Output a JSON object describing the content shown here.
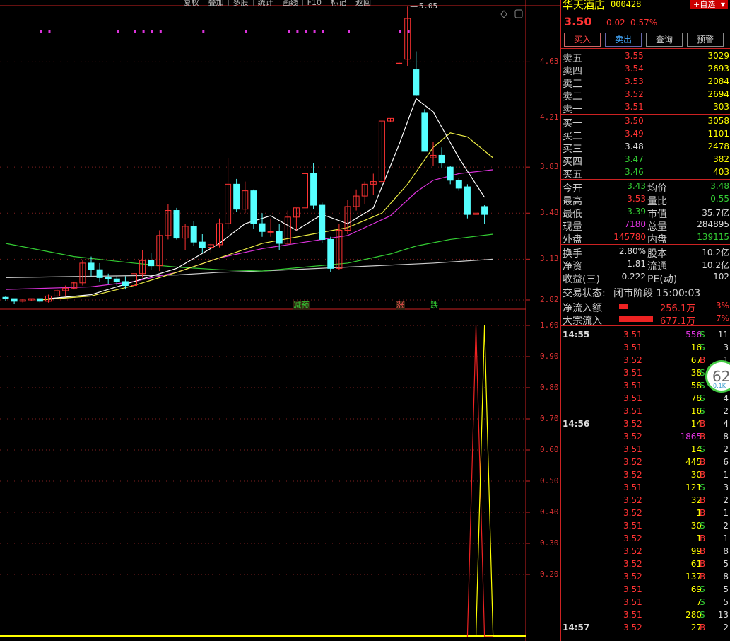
{
  "toolbar": [
    "复权",
    "叠加",
    "多股",
    "统计",
    "画线",
    "F10",
    "标记",
    "返回"
  ],
  "price_axis": [
    "4.63",
    "4.21",
    "3.83",
    "3.48",
    "3.13",
    "2.82"
  ],
  "osc_axis": [
    "1.00",
    "0.90",
    "0.80",
    "0.70",
    "0.60",
    "0.50",
    "0.40",
    "0.30",
    "0.20"
  ],
  "high_label": "5.05",
  "signals": [
    {
      "label": "减预",
      "color": "#3c3",
      "bg": "#321"
    },
    {
      "label": "涨",
      "color": "#f55",
      "bg": "#321"
    },
    {
      "label": "跌",
      "color": "#3c3",
      "bg": "#000"
    }
  ],
  "stock": {
    "name": "华天酒店",
    "code": "000428",
    "register": "+自选",
    "price": "3.50",
    "change": "0.02",
    "pct": "0.57%"
  },
  "actions": {
    "buy": "买入",
    "sell": "卖出",
    "query": "查询",
    "alert": "预警"
  },
  "asks": [
    {
      "l": "卖五",
      "p": "3.55",
      "v": "3029"
    },
    {
      "l": "卖四",
      "p": "3.54",
      "v": "2693"
    },
    {
      "l": "卖三",
      "p": "3.53",
      "v": "2084"
    },
    {
      "l": "卖二",
      "p": "3.52",
      "v": "2694"
    },
    {
      "l": "卖一",
      "p": "3.51",
      "v": "303"
    }
  ],
  "bids": [
    {
      "l": "买一",
      "p": "3.50",
      "v": "3058"
    },
    {
      "l": "买二",
      "p": "3.49",
      "v": "1101"
    },
    {
      "l": "买三",
      "p": "3.48",
      "v": "2478"
    },
    {
      "l": "买四",
      "p": "3.47",
      "v": "382"
    },
    {
      "l": "买五",
      "p": "3.46",
      "v": "403"
    }
  ],
  "stats1": [
    {
      "a": "今开",
      "av": "3.43",
      "ac": "g",
      "b": "均价",
      "bv": "3.48",
      "bc": "g"
    },
    {
      "a": "最高",
      "av": "3.53",
      "ac": "r",
      "b": "量比",
      "bv": "0.55",
      "bc": "g"
    },
    {
      "a": "最低",
      "av": "3.39",
      "ac": "g",
      "b": "市值",
      "bv": "35.7亿",
      "bc": "w"
    },
    {
      "a": "现量",
      "av": "7180",
      "ac": "m",
      "b": "总量",
      "bv": "284895",
      "bc": "w"
    },
    {
      "a": "外盘",
      "av": "145780",
      "ac": "r",
      "b": "内盘",
      "bv": "139115",
      "bc": "g"
    }
  ],
  "stats2": [
    {
      "a": "换手",
      "av": "2.80%",
      "b": "股本",
      "bv": "10.2亿"
    },
    {
      "a": "净资",
      "av": "1.81",
      "b": "流通",
      "bv": "10.2亿"
    },
    {
      "a": "收益(三)",
      "av": "-0.222",
      "b": "PE(动)",
      "bv": "102"
    }
  ],
  "status": {
    "label": "交易状态:",
    "value": "闭市阶段 15:00:03"
  },
  "flows": [
    {
      "l": "净流入额",
      "v": "256.1万",
      "p": "3%"
    },
    {
      "l": "大宗流入",
      "v": "677.1万",
      "p": "7%"
    }
  ],
  "ticks": [
    {
      "t": "14:55",
      "p": "3.51",
      "v": "556",
      "bs": "S",
      "n": "11",
      "vc": "m"
    },
    {
      "t": "",
      "p": "3.51",
      "v": "16",
      "bs": "S",
      "n": "3",
      "vc": "y"
    },
    {
      "t": "",
      "p": "3.52",
      "v": "67",
      "bs": "B",
      "n": "1",
      "vc": "y"
    },
    {
      "t": "",
      "p": "3.51",
      "v": "38",
      "bs": "S",
      "n": "4",
      "vc": "y"
    },
    {
      "t": "",
      "p": "3.51",
      "v": "58",
      "bs": "S",
      "n": "4",
      "vc": "y"
    },
    {
      "t": "",
      "p": "3.51",
      "v": "78",
      "bs": "S",
      "n": "4",
      "vc": "y"
    },
    {
      "t": "",
      "p": "3.51",
      "v": "16",
      "bs": "S",
      "n": "2",
      "vc": "y"
    },
    {
      "t": "14:56",
      "p": "3.52",
      "v": "14",
      "bs": "B",
      "n": "4",
      "vc": "y"
    },
    {
      "t": "",
      "p": "3.52",
      "v": "1865",
      "bs": "B",
      "n": "8",
      "vc": "m"
    },
    {
      "t": "",
      "p": "3.51",
      "v": "14",
      "bs": "S",
      "n": "2",
      "vc": "y"
    },
    {
      "t": "",
      "p": "3.52",
      "v": "445",
      "bs": "B",
      "n": "6",
      "vc": "y"
    },
    {
      "t": "",
      "p": "3.52",
      "v": "30",
      "bs": "B",
      "n": "1",
      "vc": "y"
    },
    {
      "t": "",
      "p": "3.51",
      "v": "121",
      "bs": "S",
      "n": "3",
      "vc": "y"
    },
    {
      "t": "",
      "p": "3.52",
      "v": "32",
      "bs": "B",
      "n": "2",
      "vc": "y"
    },
    {
      "t": "",
      "p": "3.52",
      "v": "1",
      "bs": "B",
      "n": "1",
      "vc": "y"
    },
    {
      "t": "",
      "p": "3.51",
      "v": "30",
      "bs": "S",
      "n": "2",
      "vc": "y"
    },
    {
      "t": "",
      "p": "3.52",
      "v": "1",
      "bs": "B",
      "n": "1",
      "vc": "y"
    },
    {
      "t": "",
      "p": "3.52",
      "v": "99",
      "bs": "B",
      "n": "8",
      "vc": "y"
    },
    {
      "t": "",
      "p": "3.52",
      "v": "61",
      "bs": "B",
      "n": "5",
      "vc": "y"
    },
    {
      "t": "",
      "p": "3.52",
      "v": "137",
      "bs": "B",
      "n": "8",
      "vc": "y"
    },
    {
      "t": "",
      "p": "3.51",
      "v": "69",
      "bs": "S",
      "n": "5",
      "vc": "y"
    },
    {
      "t": "",
      "p": "3.51",
      "v": "7",
      "bs": "S",
      "n": "5",
      "vc": "y"
    },
    {
      "t": "",
      "p": "3.51",
      "v": "280",
      "bs": "S",
      "n": "13",
      "vc": "y"
    },
    {
      "t": "14:57",
      "p": "3.52",
      "v": "27",
      "bs": "B",
      "n": "2",
      "vc": "y"
    }
  ],
  "badge": {
    "num": "62",
    "sub": "0.1K"
  },
  "chart_data": {
    "type": "candlestick",
    "ylim": [
      2.75,
      5.1
    ],
    "candles": [
      [
        2.84,
        2.85,
        2.81,
        2.83
      ],
      [
        2.83,
        2.83,
        2.79,
        2.81
      ],
      [
        2.81,
        2.83,
        2.8,
        2.82
      ],
      [
        2.82,
        2.83,
        2.81,
        2.83
      ],
      [
        2.83,
        2.83,
        2.8,
        2.81
      ],
      [
        2.81,
        2.86,
        2.8,
        2.85
      ],
      [
        2.85,
        2.9,
        2.84,
        2.89
      ],
      [
        2.89,
        2.93,
        2.85,
        2.91
      ],
      [
        2.91,
        2.96,
        2.9,
        2.95
      ],
      [
        2.95,
        3.12,
        2.93,
        3.1
      ],
      [
        3.1,
        3.15,
        3.0,
        3.05
      ],
      [
        3.05,
        3.1,
        2.96,
        2.99
      ],
      [
        2.99,
        3.02,
        2.94,
        2.98
      ],
      [
        2.98,
        3.0,
        2.93,
        2.96
      ],
      [
        2.96,
        3.0,
        2.9,
        2.93
      ],
      [
        2.93,
        3.05,
        2.92,
        3.02
      ],
      [
        3.02,
        3.2,
        2.99,
        3.12
      ],
      [
        3.12,
        3.18,
        3.05,
        3.08
      ],
      [
        3.08,
        3.35,
        3.04,
        3.31
      ],
      [
        3.31,
        3.55,
        3.28,
        3.5
      ],
      [
        3.5,
        3.52,
        3.28,
        3.29
      ],
      [
        3.29,
        3.4,
        3.2,
        3.38
      ],
      [
        3.38,
        3.42,
        3.23,
        3.26
      ],
      [
        3.26,
        3.32,
        3.18,
        3.22
      ],
      [
        3.22,
        3.25,
        3.18,
        3.24
      ],
      [
        3.24,
        3.44,
        3.22,
        3.4
      ],
      [
        3.4,
        3.9,
        3.36,
        3.7
      ],
      [
        3.7,
        3.74,
        3.49,
        3.51
      ],
      [
        3.51,
        3.72,
        3.48,
        3.65
      ],
      [
        3.65,
        3.66,
        3.36,
        3.4
      ],
      [
        3.4,
        3.48,
        3.3,
        3.34
      ],
      [
        3.34,
        3.44,
        3.3,
        3.34
      ],
      [
        3.34,
        3.4,
        3.2,
        3.25
      ],
      [
        3.25,
        3.5,
        3.24,
        3.45
      ],
      [
        3.45,
        3.52,
        3.35,
        3.52
      ],
      [
        3.52,
        3.8,
        3.45,
        3.78
      ],
      [
        3.78,
        3.86,
        3.51,
        3.54
      ],
      [
        3.54,
        3.56,
        3.25,
        3.28
      ],
      [
        3.28,
        3.3,
        3.03,
        3.06
      ],
      [
        3.06,
        3.4,
        3.05,
        3.35
      ],
      [
        3.35,
        3.58,
        3.32,
        3.53
      ],
      [
        3.53,
        3.66,
        3.5,
        3.61
      ],
      [
        3.61,
        3.72,
        3.55,
        3.7
      ],
      [
        3.7,
        3.78,
        3.62,
        3.72
      ],
      [
        3.72,
        4.18,
        3.7,
        4.18
      ],
      [
        4.18,
        4.2,
        4.17,
        4.2
      ],
      [
        4.62,
        4.63,
        4.61,
        4.62
      ],
      [
        4.65,
        5.05,
        4.6,
        4.96
      ],
      [
        4.57,
        4.71,
        4.37,
        4.38
      ],
      [
        4.24,
        4.27,
        3.95,
        3.95
      ],
      [
        3.9,
        4.02,
        3.84,
        3.92
      ],
      [
        3.92,
        3.98,
        3.82,
        3.86
      ],
      [
        3.83,
        3.84,
        3.7,
        3.73
      ],
      [
        3.73,
        3.75,
        3.65,
        3.67
      ],
      [
        3.68,
        3.7,
        3.44,
        3.47
      ],
      [
        3.47,
        3.56,
        3.46,
        3.48
      ],
      [
        3.53,
        3.54,
        3.4,
        3.47
      ]
    ],
    "ma_white": [
      [
        5,
        2.83
      ],
      [
        10,
        2.86
      ],
      [
        15,
        2.96
      ],
      [
        20,
        3.06
      ],
      [
        25,
        3.25
      ],
      [
        28,
        3.4
      ],
      [
        31,
        3.46
      ],
      [
        34,
        3.35
      ],
      [
        37,
        3.47
      ],
      [
        40,
        3.4
      ],
      [
        43,
        3.52
      ],
      [
        46,
        4.0
      ],
      [
        48,
        4.35
      ],
      [
        50,
        4.25
      ],
      [
        53,
        3.9
      ],
      [
        56,
        3.6
      ]
    ],
    "ma_yellow": [
      [
        4,
        2.82
      ],
      [
        10,
        2.85
      ],
      [
        15,
        2.93
      ],
      [
        20,
        3.03
      ],
      [
        25,
        3.14
      ],
      [
        30,
        3.25
      ],
      [
        35,
        3.31
      ],
      [
        40,
        3.37
      ],
      [
        44,
        3.48
      ],
      [
        47,
        3.7
      ],
      [
        50,
        3.98
      ],
      [
        52,
        4.09
      ],
      [
        54,
        4.06
      ],
      [
        57,
        3.9
      ]
    ],
    "ma_magenta": [
      [
        0,
        2.9
      ],
      [
        10,
        2.92
      ],
      [
        15,
        2.96
      ],
      [
        20,
        3.03
      ],
      [
        25,
        3.14
      ],
      [
        30,
        3.21
      ],
      [
        35,
        3.26
      ],
      [
        40,
        3.31
      ],
      [
        45,
        3.46
      ],
      [
        48,
        3.64
      ],
      [
        50,
        3.73
      ],
      [
        53,
        3.78
      ],
      [
        57,
        3.81
      ]
    ],
    "ma_green": [
      [
        0,
        3.25
      ],
      [
        8,
        3.15
      ],
      [
        15,
        3.1
      ],
      [
        20,
        3.07
      ],
      [
        25,
        3.05
      ],
      [
        30,
        3.04
      ],
      [
        35,
        3.07
      ],
      [
        40,
        3.1
      ],
      [
        45,
        3.17
      ],
      [
        48,
        3.23
      ],
      [
        52,
        3.28
      ],
      [
        57,
        3.32
      ]
    ],
    "ma_gray": [
      [
        0,
        2.99
      ],
      [
        10,
        3.0
      ],
      [
        20,
        3.01
      ],
      [
        25,
        3.03
      ],
      [
        30,
        3.04
      ],
      [
        40,
        3.07
      ],
      [
        50,
        3.1
      ],
      [
        57,
        3.13
      ]
    ],
    "osc_red": [
      [
        54,
        0
      ],
      [
        55,
        1
      ],
      [
        56,
        0
      ],
      [
        57,
        0
      ]
    ],
    "osc_yellow": [
      [
        55,
        0
      ],
      [
        56,
        1
      ],
      [
        57,
        0
      ]
    ],
    "dots_x": [
      4,
      5,
      13,
      15,
      16,
      17,
      18,
      23,
      28,
      33,
      34,
      35,
      36,
      37,
      40,
      46,
      47
    ],
    "signal_x": [
      34,
      46,
      50
    ]
  }
}
